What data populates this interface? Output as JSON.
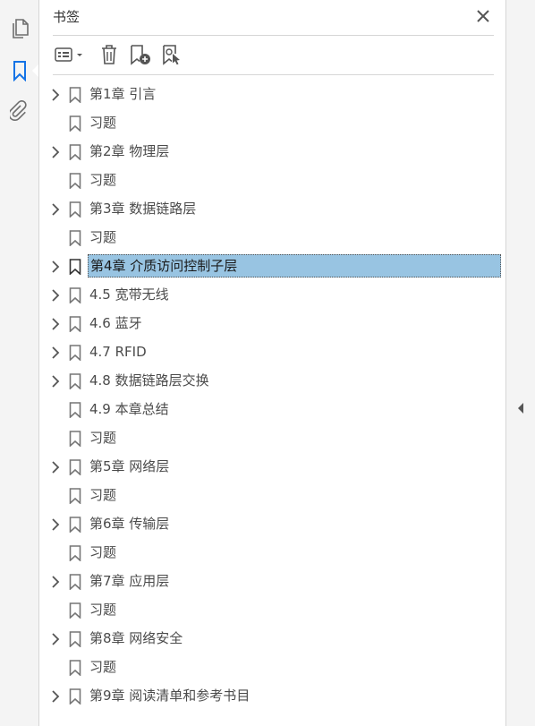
{
  "rail": {
    "icons": [
      "pages-icon",
      "bookmark-icon",
      "paperclip-icon"
    ],
    "active_color": "#1473e6",
    "icon_color": "#6e6e6e"
  },
  "panel": {
    "title": "书签",
    "toolbar": [
      "options-menu-icon",
      "delete-icon",
      "new-bookmark-icon",
      "new-bookmark-from-structure-icon"
    ]
  },
  "bookmarks": [
    {
      "label": "第1章 引言",
      "expandable": true,
      "selected": false
    },
    {
      "label": "习题",
      "expandable": false,
      "selected": false
    },
    {
      "label": "第2章 物理层",
      "expandable": true,
      "selected": false
    },
    {
      "label": "习题",
      "expandable": false,
      "selected": false
    },
    {
      "label": "第3章 数据链路层",
      "expandable": true,
      "selected": false
    },
    {
      "label": "习题",
      "expandable": false,
      "selected": false
    },
    {
      "label": "第4章 介质访问控制子层",
      "expandable": true,
      "selected": true
    },
    {
      "label": "4.5 宽带无线",
      "expandable": true,
      "selected": false
    },
    {
      "label": "4.6 蓝牙",
      "expandable": true,
      "selected": false
    },
    {
      "label": "4.7 RFID",
      "expandable": true,
      "selected": false
    },
    {
      "label": "4.8 数据链路层交换",
      "expandable": true,
      "selected": false
    },
    {
      "label": "4.9 本章总结",
      "expandable": false,
      "selected": false
    },
    {
      "label": "习题",
      "expandable": false,
      "selected": false
    },
    {
      "label": "第5章 网络层",
      "expandable": true,
      "selected": false
    },
    {
      "label": "习题",
      "expandable": false,
      "selected": false
    },
    {
      "label": "第6章 传输层",
      "expandable": true,
      "selected": false
    },
    {
      "label": "习题",
      "expandable": false,
      "selected": false
    },
    {
      "label": "第7章 应用层",
      "expandable": true,
      "selected": false
    },
    {
      "label": "习题",
      "expandable": false,
      "selected": false
    },
    {
      "label": "第8章 网络安全",
      "expandable": true,
      "selected": false
    },
    {
      "label": "习题",
      "expandable": false,
      "selected": false
    },
    {
      "label": "第9章 阅读清单和参考书目",
      "expandable": true,
      "selected": false
    }
  ],
  "colors": {
    "selection": "#98c4e2",
    "text": "#4b4b4b",
    "icon": "#6e6e6e"
  }
}
